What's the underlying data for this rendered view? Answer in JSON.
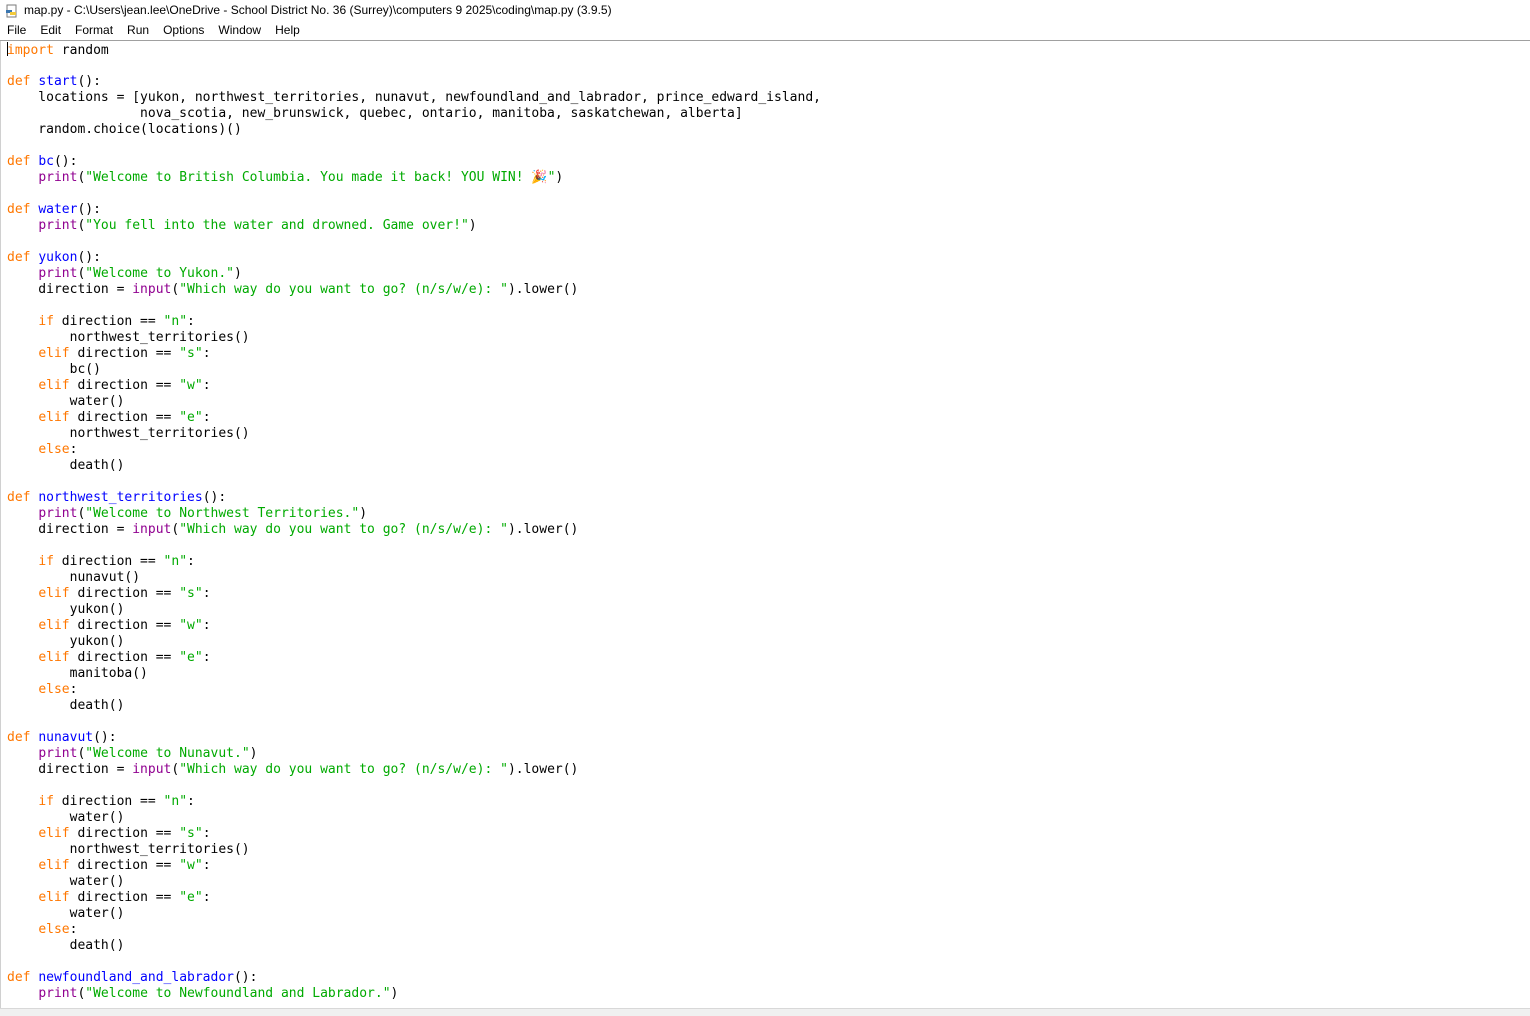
{
  "window": {
    "title": "map.py - C:\\Users\\jean.lee\\OneDrive - School District No. 36 (Surrey)\\computers 9 2025\\coding\\map.py (3.9.5)",
    "icon": "python-file-icon"
  },
  "menu": [
    "File",
    "Edit",
    "Format",
    "Run",
    "Options",
    "Window",
    "Help"
  ],
  "colors": {
    "keyword": "#ff7700",
    "definition": "#0000ff",
    "builtin": "#900090",
    "string": "#00aa00",
    "text": "#000000"
  },
  "code": [
    [
      [
        "kw",
        "import"
      ],
      [
        "",
        " random"
      ]
    ],
    [],
    [
      [
        "kw",
        "def"
      ],
      [
        "",
        " "
      ],
      [
        "def",
        "start"
      ],
      [
        "",
        "():"
      ]
    ],
    [
      [
        "",
        "    locations = [yukon, northwest_territories, nunavut, newfoundland_and_labrador, prince_edward_island,"
      ]
    ],
    [
      [
        "",
        "                 nova_scotia, new_brunswick, quebec, ontario, manitoba, saskatchewan, alberta]"
      ]
    ],
    [
      [
        "",
        "    random.choice(locations)()"
      ]
    ],
    [],
    [
      [
        "kw",
        "def"
      ],
      [
        "",
        " "
      ],
      [
        "def",
        "bc"
      ],
      [
        "",
        "():"
      ]
    ],
    [
      [
        "",
        "    "
      ],
      [
        "bi",
        "print"
      ],
      [
        "",
        "("
      ],
      [
        "str",
        "\"Welcome to British Columbia. You made it back! YOU WIN! 🎉\""
      ],
      [
        "",
        ")"
      ]
    ],
    [],
    [
      [
        "kw",
        "def"
      ],
      [
        "",
        " "
      ],
      [
        "def",
        "water"
      ],
      [
        "",
        "():"
      ]
    ],
    [
      [
        "",
        "    "
      ],
      [
        "bi",
        "print"
      ],
      [
        "",
        "("
      ],
      [
        "str",
        "\"You fell into the water and drowned. Game over!\""
      ],
      [
        "",
        ")"
      ]
    ],
    [],
    [
      [
        "kw",
        "def"
      ],
      [
        "",
        " "
      ],
      [
        "def",
        "yukon"
      ],
      [
        "",
        "():"
      ]
    ],
    [
      [
        "",
        "    "
      ],
      [
        "bi",
        "print"
      ],
      [
        "",
        "("
      ],
      [
        "str",
        "\"Welcome to Yukon.\""
      ],
      [
        "",
        ")"
      ]
    ],
    [
      [
        "",
        "    direction = "
      ],
      [
        "bi",
        "input"
      ],
      [
        "",
        "("
      ],
      [
        "str",
        "\"Which way do you want to go? (n/s/w/e): \""
      ],
      [
        "",
        ").lower()"
      ]
    ],
    [],
    [
      [
        "",
        "    "
      ],
      [
        "kw",
        "if"
      ],
      [
        "",
        " direction == "
      ],
      [
        "str",
        "\"n\""
      ],
      [
        "",
        ":"
      ]
    ],
    [
      [
        "",
        "        northwest_territories()"
      ]
    ],
    [
      [
        "",
        "    "
      ],
      [
        "kw",
        "elif"
      ],
      [
        "",
        " direction == "
      ],
      [
        "str",
        "\"s\""
      ],
      [
        "",
        ":"
      ]
    ],
    [
      [
        "",
        "        bc()"
      ]
    ],
    [
      [
        "",
        "    "
      ],
      [
        "kw",
        "elif"
      ],
      [
        "",
        " direction == "
      ],
      [
        "str",
        "\"w\""
      ],
      [
        "",
        ":"
      ]
    ],
    [
      [
        "",
        "        water()"
      ]
    ],
    [
      [
        "",
        "    "
      ],
      [
        "kw",
        "elif"
      ],
      [
        "",
        " direction == "
      ],
      [
        "str",
        "\"e\""
      ],
      [
        "",
        ":"
      ]
    ],
    [
      [
        "",
        "        northwest_territories()"
      ]
    ],
    [
      [
        "",
        "    "
      ],
      [
        "kw",
        "else"
      ],
      [
        "",
        ":"
      ]
    ],
    [
      [
        "",
        "        death()"
      ]
    ],
    [],
    [
      [
        "kw",
        "def"
      ],
      [
        "",
        " "
      ],
      [
        "def",
        "northwest_territories"
      ],
      [
        "",
        "():"
      ]
    ],
    [
      [
        "",
        "    "
      ],
      [
        "bi",
        "print"
      ],
      [
        "",
        "("
      ],
      [
        "str",
        "\"Welcome to Northwest Territories.\""
      ],
      [
        "",
        ")"
      ]
    ],
    [
      [
        "",
        "    direction = "
      ],
      [
        "bi",
        "input"
      ],
      [
        "",
        "("
      ],
      [
        "str",
        "\"Which way do you want to go? (n/s/w/e): \""
      ],
      [
        "",
        ").lower()"
      ]
    ],
    [],
    [
      [
        "",
        "    "
      ],
      [
        "kw",
        "if"
      ],
      [
        "",
        " direction == "
      ],
      [
        "str",
        "\"n\""
      ],
      [
        "",
        ":"
      ]
    ],
    [
      [
        "",
        "        nunavut()"
      ]
    ],
    [
      [
        "",
        "    "
      ],
      [
        "kw",
        "elif"
      ],
      [
        "",
        " direction == "
      ],
      [
        "str",
        "\"s\""
      ],
      [
        "",
        ":"
      ]
    ],
    [
      [
        "",
        "        yukon()"
      ]
    ],
    [
      [
        "",
        "    "
      ],
      [
        "kw",
        "elif"
      ],
      [
        "",
        " direction == "
      ],
      [
        "str",
        "\"w\""
      ],
      [
        "",
        ":"
      ]
    ],
    [
      [
        "",
        "        yukon()"
      ]
    ],
    [
      [
        "",
        "    "
      ],
      [
        "kw",
        "elif"
      ],
      [
        "",
        " direction == "
      ],
      [
        "str",
        "\"e\""
      ],
      [
        "",
        ":"
      ]
    ],
    [
      [
        "",
        "        manitoba()"
      ]
    ],
    [
      [
        "",
        "    "
      ],
      [
        "kw",
        "else"
      ],
      [
        "",
        ":"
      ]
    ],
    [
      [
        "",
        "        death()"
      ]
    ],
    [],
    [
      [
        "kw",
        "def"
      ],
      [
        "",
        " "
      ],
      [
        "def",
        "nunavut"
      ],
      [
        "",
        "():"
      ]
    ],
    [
      [
        "",
        "    "
      ],
      [
        "bi",
        "print"
      ],
      [
        "",
        "("
      ],
      [
        "str",
        "\"Welcome to Nunavut.\""
      ],
      [
        "",
        ")"
      ]
    ],
    [
      [
        "",
        "    direction = "
      ],
      [
        "bi",
        "input"
      ],
      [
        "",
        "("
      ],
      [
        "str",
        "\"Which way do you want to go? (n/s/w/e): \""
      ],
      [
        "",
        ").lower()"
      ]
    ],
    [],
    [
      [
        "",
        "    "
      ],
      [
        "kw",
        "if"
      ],
      [
        "",
        " direction == "
      ],
      [
        "str",
        "\"n\""
      ],
      [
        "",
        ":"
      ]
    ],
    [
      [
        "",
        "        water()"
      ]
    ],
    [
      [
        "",
        "    "
      ],
      [
        "kw",
        "elif"
      ],
      [
        "",
        " direction == "
      ],
      [
        "str",
        "\"s\""
      ],
      [
        "",
        ":"
      ]
    ],
    [
      [
        "",
        "        northwest_territories()"
      ]
    ],
    [
      [
        "",
        "    "
      ],
      [
        "kw",
        "elif"
      ],
      [
        "",
        " direction == "
      ],
      [
        "str",
        "\"w\""
      ],
      [
        "",
        ":"
      ]
    ],
    [
      [
        "",
        "        water()"
      ]
    ],
    [
      [
        "",
        "    "
      ],
      [
        "kw",
        "elif"
      ],
      [
        "",
        " direction == "
      ],
      [
        "str",
        "\"e\""
      ],
      [
        "",
        ":"
      ]
    ],
    [
      [
        "",
        "        water()"
      ]
    ],
    [
      [
        "",
        "    "
      ],
      [
        "kw",
        "else"
      ],
      [
        "",
        ":"
      ]
    ],
    [
      [
        "",
        "        death()"
      ]
    ],
    [],
    [
      [
        "kw",
        "def"
      ],
      [
        "",
        " "
      ],
      [
        "def",
        "newfoundland_and_labrador"
      ],
      [
        "",
        "():"
      ]
    ],
    [
      [
        "",
        "    "
      ],
      [
        "bi",
        "print"
      ],
      [
        "",
        "("
      ],
      [
        "str",
        "\"Welcome to Newfoundland and Labrador.\""
      ],
      [
        "",
        ")"
      ]
    ]
  ]
}
